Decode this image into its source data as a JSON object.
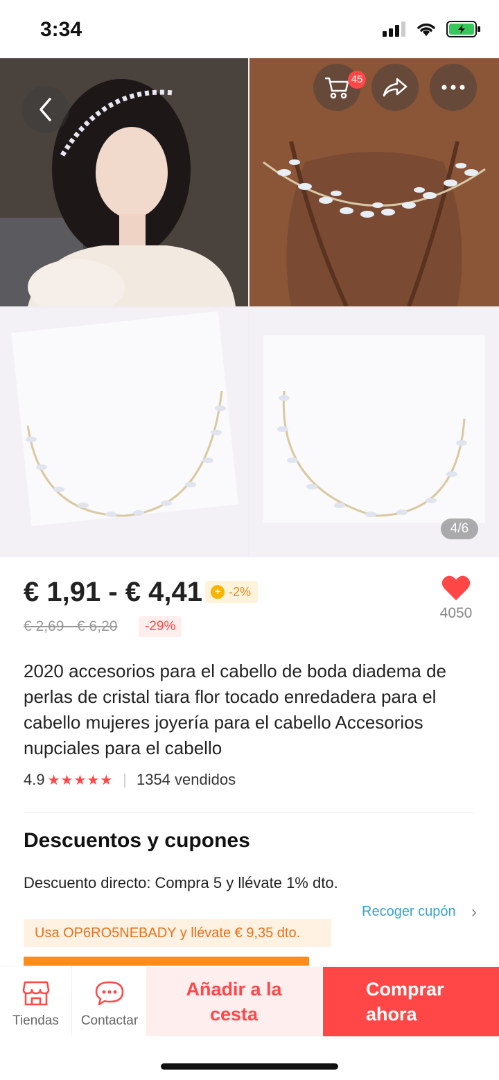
{
  "status_bar": {
    "time": "3:34"
  },
  "gallery": {
    "cart_count": "45",
    "page_indicator": "4/6"
  },
  "product": {
    "price_range": "€ 1,91 - € 4,41",
    "coin_discount": "-2%",
    "original_price": "€ 2,69 - € 6,20",
    "discount_percent": "-29%",
    "wishlist_count": "4050",
    "title": "2020 accesorios para el cabello de boda diadema de perlas de cristal tiara flor tocado enredadera para el cabello mujeres joyería para el cabello Accesorios nupciales para el cabello",
    "rating": "4.9",
    "stars": "★★★★★",
    "sold": "1354 vendidos"
  },
  "coupons": {
    "section_title": "Descuentos y cupones",
    "direct_discount": "Descuento directo: Compra 5 y llévate 1% dto.",
    "collect_link": "Recoger cupón",
    "code_promo": "Usa OP6RO5NEBADY y llévate € 9,35 dto."
  },
  "bottom_bar": {
    "stores_label": "Tiendas",
    "contact_label": "Contactar",
    "add_to_cart_label": "Añadir a la cesta",
    "buy_now_label": "Comprar ahora"
  },
  "colors": {
    "accent": "#ff4747",
    "coupon_orange": "#e8701a",
    "link_blue": "#3aa0d0"
  },
  "icons": [
    "back-icon",
    "cart-icon",
    "share-icon",
    "more-icon",
    "heart-icon",
    "store-icon",
    "chat-icon",
    "coin-icon"
  ]
}
